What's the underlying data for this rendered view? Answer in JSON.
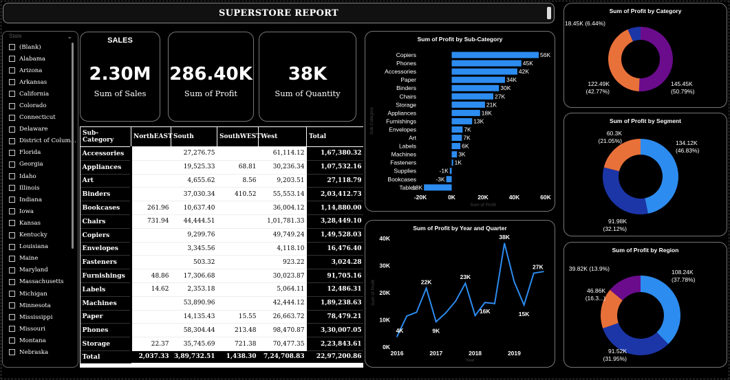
{
  "report_title": "SUPERSTORE REPORT",
  "kpis": {
    "sales_caption": "SALES",
    "sales_value": "2.30M",
    "sales_label": "Sum of Sales",
    "profit_value": "286.40K",
    "profit_label": "Sum of Profit",
    "qty_value": "38K",
    "qty_label": "Sum of Quantity"
  },
  "slicer": {
    "header": "State",
    "items": [
      "(Blank)",
      "Alabama",
      "Arizona",
      "Arkansas",
      "California",
      "Colorado",
      "Connecticut",
      "Delaware",
      "District of Colum...",
      "Florida",
      "Georgia",
      "Idaho",
      "Illinois",
      "Indiana",
      "Iowa",
      "Kansas",
      "Kentucky",
      "Louisiana",
      "Maine",
      "Maryland",
      "Massachusetts",
      "Michigan",
      "Minnesota",
      "Mississippi",
      "Missouri",
      "Montana",
      "Nebraska"
    ]
  },
  "matrix": {
    "headers": [
      "Sub-Category",
      "NorthEAST",
      "South",
      "SouthWEST",
      "West",
      "Total"
    ],
    "rows": [
      {
        "cat": "Accessories",
        "ne": "",
        "south": "27,276.75",
        "sw": "",
        "west": "61,114.12",
        "total": "1,67,380.32"
      },
      {
        "cat": "Appliances",
        "ne": "",
        "south": "19,525.33",
        "sw": "68.81",
        "west": "30,236.34",
        "total": "1,07,532.16"
      },
      {
        "cat": "Art",
        "ne": "",
        "south": "4,655.62",
        "sw": "8.56",
        "west": "9,203.51",
        "total": "27,118.79"
      },
      {
        "cat": "Binders",
        "ne": "",
        "south": "37,030.34",
        "sw": "410.52",
        "west": "55,553.14",
        "total": "2,03,412.73"
      },
      {
        "cat": "Bookcases",
        "ne": "261.96",
        "south": "10,637.40",
        "sw": "",
        "west": "36,004.12",
        "total": "1,14,880.00"
      },
      {
        "cat": "Chairs",
        "ne": "731.94",
        "south": "44,444.51",
        "sw": "",
        "west": "1,01,781.33",
        "total": "3,28,449.10"
      },
      {
        "cat": "Copiers",
        "ne": "",
        "south": "9,299.76",
        "sw": "",
        "west": "49,749.24",
        "total": "1,49,528.03"
      },
      {
        "cat": "Envelopes",
        "ne": "",
        "south": "3,345.56",
        "sw": "",
        "west": "4,118.10",
        "total": "16,476.40"
      },
      {
        "cat": "Fasteners",
        "ne": "",
        "south": "503.32",
        "sw": "",
        "west": "923.22",
        "total": "3,024.28"
      },
      {
        "cat": "Furnishings",
        "ne": "48.86",
        "south": "17,306.68",
        "sw": "",
        "west": "30,023.87",
        "total": "91,705.16"
      },
      {
        "cat": "Labels",
        "ne": "14.62",
        "south": "2,353.18",
        "sw": "",
        "west": "5,064.11",
        "total": "12,486.31"
      },
      {
        "cat": "Machines",
        "ne": "",
        "south": "53,890.96",
        "sw": "",
        "west": "42,444.12",
        "total": "1,89,238.63"
      },
      {
        "cat": "Paper",
        "ne": "",
        "south": "14,135.43",
        "sw": "15.55",
        "west": "26,663.72",
        "total": "78,479.21"
      },
      {
        "cat": "Phones",
        "ne": "",
        "south": "58,304.44",
        "sw": "213.48",
        "west": "98,470.87",
        "total": "3,30,007.05"
      },
      {
        "cat": "Storage",
        "ne": "22.37",
        "south": "35,745.69",
        "sw": "721.38",
        "west": "70,477.35",
        "total": "2,23,843.61"
      }
    ],
    "total_row": {
      "cat": "Total",
      "ne": "2,037.33",
      "south": "3,89,732.51",
      "sw": "1,438.30",
      "west": "7,24,708.83",
      "total": "22,97,200.86"
    }
  },
  "chart_data": [
    {
      "id": "subcat",
      "type": "bar",
      "orientation": "horizontal",
      "title": "Sum of Profit by Sub-Category",
      "xlabel": "Sum of Profit",
      "ylabel": "Sub-Category",
      "categories": [
        "Copiers",
        "Phones",
        "Accessories",
        "Paper",
        "Binders",
        "Chairs",
        "Storage",
        "Appliances",
        "Furnishings",
        "Envelopes",
        "Art",
        "Labels",
        "Machines",
        "Fasteners",
        "Supplies",
        "Bookcases",
        "Tables"
      ],
      "values": [
        55618,
        44516,
        41937,
        34054,
        30222,
        26590,
        21279,
        18138,
        13059,
        6964,
        6528,
        5546,
        3385,
        950,
        -1189,
        -3473,
        -17725
      ],
      "labels": [
        "56K",
        "45K",
        "42K",
        "34K",
        "30K",
        "27K",
        "21K",
        "18K",
        "13K",
        "7K",
        "7K",
        "6K",
        "3K",
        "1K",
        "-1K",
        "-3K",
        "-18K"
      ],
      "xlim": [
        -20000,
        60000
      ],
      "xticks": [
        "-20K",
        "0K",
        "20K",
        "40K",
        "60K"
      ],
      "bar_color": "#2D8CF0"
    },
    {
      "id": "yearq",
      "type": "line",
      "title": "Sum of Profit by Year and Quarter",
      "xlabel": "Year",
      "ylabel": "Sum of Profit",
      "values": [
        3800,
        11400,
        12800,
        21700,
        9300,
        12600,
        16900,
        23500,
        11600,
        16400,
        16000,
        38200,
        24000,
        15500,
        27200,
        27800
      ],
      "point_labels": [
        {
          "i": 0,
          "text": "4K"
        },
        {
          "i": 3,
          "text": "22K"
        },
        {
          "i": 4,
          "text": "9K"
        },
        {
          "i": 7,
          "text": "23K"
        },
        {
          "i": 9,
          "text": "16K"
        },
        {
          "i": 11,
          "text": "38K"
        },
        {
          "i": 13,
          "text": "15K"
        },
        {
          "i": 14,
          "text": "27K"
        }
      ],
      "xticks": [
        "2016",
        "2017",
        "2018",
        "2019"
      ],
      "ylim": [
        0,
        40000
      ],
      "yticks": [
        "0K",
        "10K",
        "20K",
        "30K",
        "40K"
      ],
      "line_color": "#2D8CF0"
    },
    {
      "id": "category",
      "type": "pie",
      "donut": true,
      "title": "Sum of Profit by Category",
      "slices": [
        {
          "name": "Technology",
          "value": 145.45,
          "label": "145.45K",
          "pct": "(50.79%)",
          "color": "#6A0C8C"
        },
        {
          "name": "Office Supplies",
          "value": 122.49,
          "label": "122.49K",
          "pct": "(42.77%)",
          "color": "#E8713A"
        },
        {
          "name": "Furniture",
          "value": 18.45,
          "label": "18.45K (6.44%)",
          "pct": "",
          "color": "#1C36A8"
        }
      ]
    },
    {
      "id": "segment",
      "type": "pie",
      "donut": true,
      "title": "Sum of Profit by Segment",
      "slices": [
        {
          "name": "Consumer",
          "value": 134.12,
          "label": "134.12K",
          "pct": "(46.83%)",
          "color": "#2D8CF0"
        },
        {
          "name": "Corporate",
          "value": 91.98,
          "label": "91.98K",
          "pct": "(32.12%)",
          "color": "#1C36A8"
        },
        {
          "name": "Home Office",
          "value": 60.3,
          "label": "60.3K",
          "pct": "(21.05%)",
          "color": "#E8713A"
        }
      ]
    },
    {
      "id": "region",
      "type": "pie",
      "donut": true,
      "title": "Sum of Profit by Region",
      "slices": [
        {
          "name": "West",
          "value": 108.24,
          "label": "108.24K",
          "pct": "(37.78%)",
          "color": "#2D8CF0"
        },
        {
          "name": "East",
          "value": 91.52,
          "label": "91.52K",
          "pct": "(31.95%)",
          "color": "#1C36A8"
        },
        {
          "name": "South",
          "value": 46.86,
          "label": "46.86K",
          "pct": "(16.3...)",
          "color": "#E8713A"
        },
        {
          "name": "Central",
          "value": 39.82,
          "label": "39.82K (13.9%)",
          "pct": "",
          "color": "#6A0C8C"
        }
      ]
    }
  ]
}
